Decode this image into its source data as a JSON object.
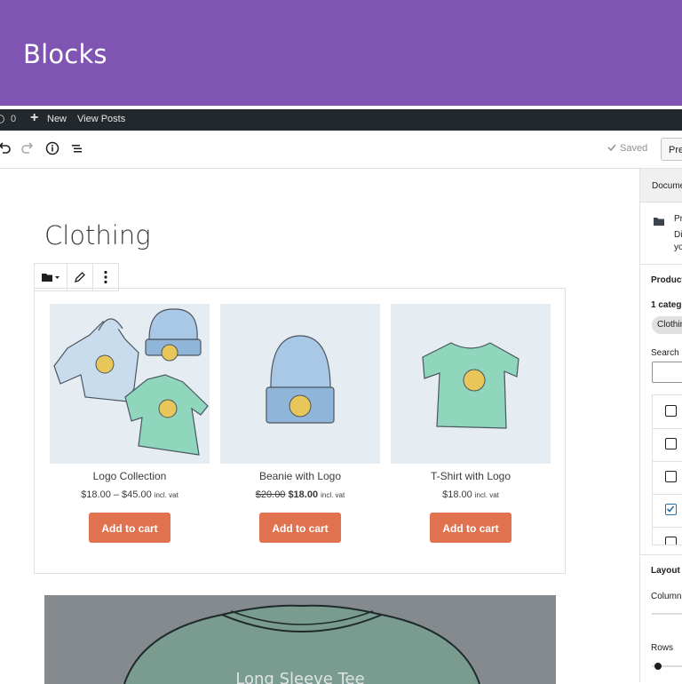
{
  "banner": {
    "title": "Blocks"
  },
  "admin_bar": {
    "comment_count": "0",
    "new_label": "New",
    "view_posts_label": "View Posts"
  },
  "toolbar": {
    "saved_label": "Saved",
    "preview_label": "Pre"
  },
  "page": {
    "title": "Clothing"
  },
  "products": [
    {
      "name": "Logo Collection",
      "price": "$18.00 – $45.00",
      "old_price": "",
      "new_price": "",
      "vat": "incl. vat",
      "button": "Add to cart"
    },
    {
      "name": "Beanie with Logo",
      "price": "",
      "old_price": "$20.00",
      "new_price": "$18.00",
      "vat": "incl. vat",
      "button": "Add to cart"
    },
    {
      "name": "T-Shirt with Logo",
      "price": "$18.00",
      "old_price": "",
      "new_price": "",
      "vat": "incl. vat",
      "button": "Add to cart"
    }
  ],
  "cover": {
    "text": "Long Sleeve Tee"
  },
  "sidebar": {
    "tab_document": "Docume",
    "category_line1": "Pr",
    "category_line2": "Di",
    "category_line3": "yo",
    "products_heading": "Product",
    "selected_count": "1 categ",
    "chip": "Clothin",
    "search_label": "Search",
    "checkboxes": [
      false,
      false,
      false,
      true,
      false
    ],
    "layout_heading": "Layout",
    "columns_label": "Column",
    "rows_label": "Rows"
  },
  "colors": {
    "brand_purple": "#7f54b3",
    "admin_bar": "#23282d",
    "add_to_cart": "#e07250",
    "checkbox_accent": "#2271b1"
  }
}
